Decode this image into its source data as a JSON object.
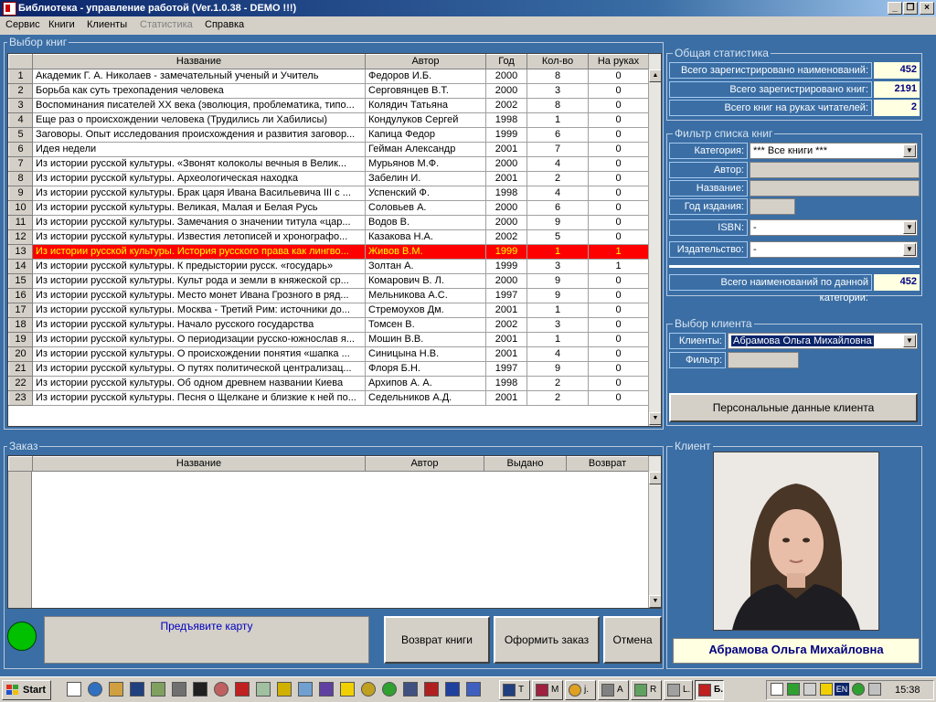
{
  "window": {
    "title": "Библиотека - управление работой (Ver.1.0.38 - DEMO !!!)"
  },
  "menu": [
    "Сервис",
    "Книги",
    "Клиенты",
    "Статистика",
    "Справка"
  ],
  "books": {
    "legend": "Выбор книг",
    "columns": [
      "Название",
      "Автор",
      "Год",
      "Кол-во",
      "На руках"
    ],
    "rows": [
      {
        "n": "1",
        "title": "Академик Г. А. Николаев - замечательный ученый и Учитель",
        "author": "Федоров И.Б.",
        "year": "2000",
        "qty": "8",
        "out": "0"
      },
      {
        "n": "2",
        "title": "Борьба как суть трехопадения человека",
        "author": "Серговянцев В.Т.",
        "year": "2000",
        "qty": "3",
        "out": "0"
      },
      {
        "n": "3",
        "title": "Воспоминания писателей XX века (эволюция, проблематика, типо...",
        "author": "Колядич Татьяна",
        "year": "2002",
        "qty": "8",
        "out": "0"
      },
      {
        "n": "4",
        "title": "Еще раз о происхождении человека (Трудились ли Хабилисы)",
        "author": "Кондулуков Сергей",
        "year": "1998",
        "qty": "1",
        "out": "0"
      },
      {
        "n": "5",
        "title": "Заговоры. Опыт исследования происхождения и развития заговор...",
        "author": "Капица Федор",
        "year": "1999",
        "qty": "6",
        "out": "0"
      },
      {
        "n": "6",
        "title": "Идея недели",
        "author": "Гейман Александр",
        "year": "2001",
        "qty": "7",
        "out": "0"
      },
      {
        "n": "7",
        "title": "Из истории русской культуры. «Звонят колоколы вечныя в Велик...",
        "author": "Мурьянов М.Ф.",
        "year": "2000",
        "qty": "4",
        "out": "0"
      },
      {
        "n": "8",
        "title": "Из истории русской культуры. Археологическая находка",
        "author": "Забелин И.",
        "year": "2001",
        "qty": "2",
        "out": "0"
      },
      {
        "n": "9",
        "title": "Из истории русской культуры. Брак царя Ивана Васильевича III с ...",
        "author": "Успенский Ф.",
        "year": "1998",
        "qty": "4",
        "out": "0"
      },
      {
        "n": "10",
        "title": "Из истории русской культуры. Великая, Малая и Белая Русь",
        "author": "Соловьев А.",
        "year": "2000",
        "qty": "6",
        "out": "0"
      },
      {
        "n": "11",
        "title": "Из истории русской культуры. Замечания о значении титула «цар...",
        "author": "Водов В.",
        "year": "2000",
        "qty": "9",
        "out": "0"
      },
      {
        "n": "12",
        "title": "Из истории русской культуры. Известия летописей и хронографо...",
        "author": "Казакова Н.А.",
        "year": "2002",
        "qty": "5",
        "out": "0"
      },
      {
        "n": "13",
        "title": "Из истории русской культуры. История русского права как лингво...",
        "author": "Живов В.М.",
        "year": "1999",
        "qty": "1",
        "out": "1"
      },
      {
        "n": "14",
        "title": "Из истории русской культуры. К предыстории русск. «государь»",
        "author": "Золтан А.",
        "year": "1999",
        "qty": "3",
        "out": "1"
      },
      {
        "n": "15",
        "title": "Из истории русской культуры. Культ рода и земли в княжеской ср...",
        "author": "Комарович В. Л.",
        "year": "2000",
        "qty": "9",
        "out": "0"
      },
      {
        "n": "16",
        "title": "Из истории русской культуры. Место монет Ивана Грозного в ряд...",
        "author": "Мельникова А.С.",
        "year": "1997",
        "qty": "9",
        "out": "0"
      },
      {
        "n": "17",
        "title": "Из истории русской культуры. Москва - Третий Рим: источники до...",
        "author": "Стремоухов Дм.",
        "year": "2001",
        "qty": "1",
        "out": "0"
      },
      {
        "n": "18",
        "title": "Из истории русской культуры. Начало русского государства",
        "author": "Томсен В.",
        "year": "2002",
        "qty": "3",
        "out": "0"
      },
      {
        "n": "19",
        "title": "Из истории русской культуры. О периодизации русско-южнослав я...",
        "author": "Мошин В.В.",
        "year": "2001",
        "qty": "1",
        "out": "0"
      },
      {
        "n": "20",
        "title": "Из истории русской культуры. О происхождении понятия «шапка ...",
        "author": "Синицына Н.В.",
        "year": "2001",
        "qty": "4",
        "out": "0"
      },
      {
        "n": "21",
        "title": "Из истории русской культуры. О путях политической централизац...",
        "author": "Флоря Б.Н.",
        "year": "1997",
        "qty": "9",
        "out": "0"
      },
      {
        "n": "22",
        "title": "Из истории русской культуры. Об одном древнем названии Киева",
        "author": "Архипов А. А.",
        "year": "1998",
        "qty": "2",
        "out": "0"
      },
      {
        "n": "23",
        "title": "Из истории русской культуры. Песня о Щелкане и близкие к ней по...",
        "author": "Седельников А.Д.",
        "year": "2001",
        "qty": "2",
        "out": "0"
      }
    ]
  },
  "stats": {
    "legend": "Общая статистика",
    "total_titles_label": "Всего зарегистрировано наименований:",
    "total_titles": "452",
    "total_books_label": "Всего зарегистрировано книг:",
    "total_books": "2191",
    "on_hand_label": "Всего книг на руках читателей:",
    "on_hand": "2"
  },
  "filter": {
    "legend": "Фильтр списка книг",
    "category_label": "Категория:",
    "category_value": "*** Все книги ***",
    "author_label": "Автор:",
    "title_label": "Название:",
    "year_label": "Год издания:",
    "isbn_label": "ISBN:",
    "isbn_value": "-",
    "publisher_label": "Издательство:",
    "publisher_value": "-",
    "count_label": "Всего наименований по данной категории:",
    "count_value": "452"
  },
  "client_select": {
    "legend": "Выбор клиента",
    "clients_label": "Клиенты:",
    "clients_value": "Абрамова Ольга Михайловна",
    "filter_label": "Фильтр:",
    "personal_button": "Персональные данные клиента"
  },
  "order": {
    "legend": "Заказ",
    "columns": [
      "Название",
      "Автор",
      "Выдано",
      "Возврат"
    ],
    "card_message": "Предъявите карту",
    "return_button": "Возврат книги",
    "order_button": "Оформить заказ",
    "cancel_button": "Отмена"
  },
  "client": {
    "legend": "Клиент",
    "name": "Абрамова Ольга Михайловна"
  },
  "taskbar": {
    "start": "Start",
    "tasks": [
      "T",
      "M",
      "j.",
      "A",
      "R",
      "L.",
      "Б."
    ],
    "lang": "EN",
    "clock": "15:38"
  },
  "colors": {
    "background": "#3a6ea5",
    "selected_row": "#ff0000",
    "selected_text": "#ffff00",
    "status_light": "#00c000"
  }
}
